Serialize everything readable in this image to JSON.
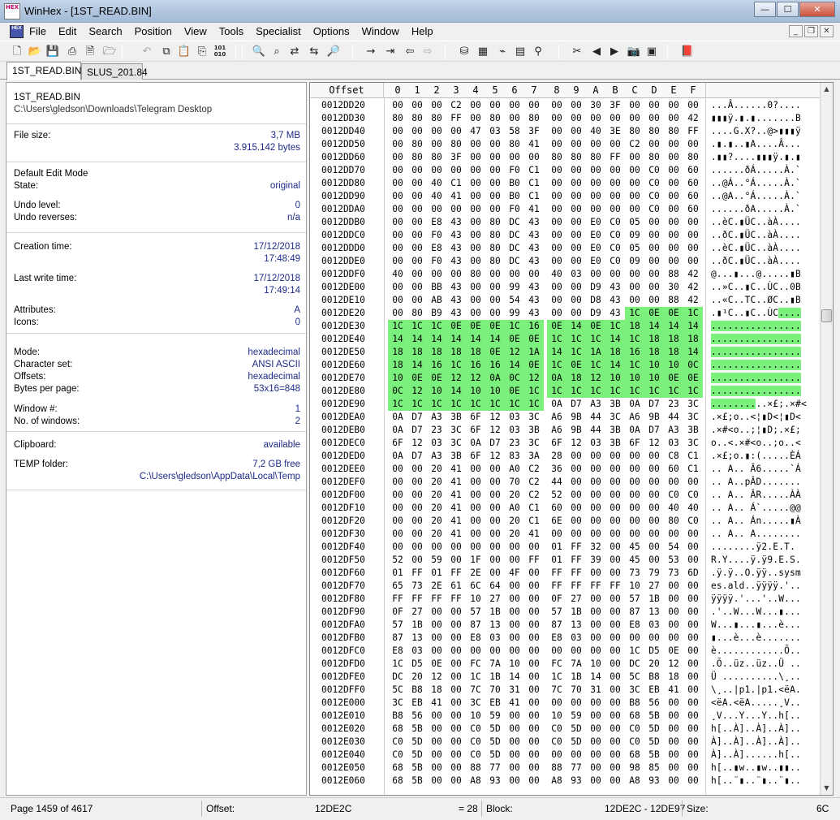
{
  "window": {
    "title": "WinHex - [1ST_READ.BIN]",
    "logo_text": "HEX",
    "minimize": "—",
    "maximize": "☐",
    "close": "✕"
  },
  "menu": {
    "items": [
      "File",
      "Edit",
      "Search",
      "Position",
      "View",
      "Tools",
      "Specialist",
      "Options",
      "Window",
      "Help"
    ]
  },
  "mdi": {
    "minimize": "_",
    "restore": "❐",
    "close": "✕"
  },
  "toolbar": {
    "icons": [
      {
        "name": "new-file-icon",
        "glyph": "🗋"
      },
      {
        "name": "open-folder-icon",
        "glyph": "📂"
      },
      {
        "name": "save-icon",
        "glyph": "💾",
        "dim": true
      },
      {
        "name": "print-icon",
        "glyph": "⎙"
      },
      {
        "name": "properties-icon",
        "glyph": "🗎"
      },
      {
        "name": "open-disk-icon",
        "glyph": "🗁"
      },
      {
        "name": "undo-icon",
        "glyph": "↶",
        "dim": true
      },
      {
        "name": "copy-icon",
        "glyph": "⧉"
      },
      {
        "name": "paste-icon",
        "glyph": "📋"
      },
      {
        "name": "paste-block-icon",
        "glyph": "⎘"
      },
      {
        "name": "binary-icon",
        "glyph": "101 010",
        "small": true
      },
      {
        "name": "find-text-icon",
        "glyph": "🔍"
      },
      {
        "name": "find-hex-icon",
        "glyph": "⌕"
      },
      {
        "name": "replace-text-icon",
        "glyph": "⇄"
      },
      {
        "name": "replace-hex-icon",
        "glyph": "⇆"
      },
      {
        "name": "find-again-icon",
        "glyph": "🔎"
      },
      {
        "name": "goto-offset-icon",
        "glyph": "→"
      },
      {
        "name": "goto-sector-icon",
        "glyph": "⇥"
      },
      {
        "name": "back-icon",
        "glyph": "⇦"
      },
      {
        "name": "forward-icon",
        "glyph": "⇨",
        "dim": true
      },
      {
        "name": "disk-editor-icon",
        "glyph": "⛁"
      },
      {
        "name": "ram-editor-icon",
        "glyph": "▦"
      },
      {
        "name": "disk-tools-icon",
        "glyph": "⌁"
      },
      {
        "name": "calculator-icon",
        "glyph": "▤"
      },
      {
        "name": "hash-icon",
        "glyph": "⚲"
      },
      {
        "name": "analyze-icon",
        "glyph": "✂"
      },
      {
        "name": "prev-page-icon",
        "glyph": "◀"
      },
      {
        "name": "next-page-icon",
        "glyph": "▶"
      },
      {
        "name": "camera-icon",
        "glyph": "📷"
      },
      {
        "name": "table-icon",
        "glyph": "▣"
      },
      {
        "name": "help-book-icon",
        "glyph": "📕"
      }
    ]
  },
  "tabs": [
    {
      "label": "1ST_READ.BIN",
      "active": true
    },
    {
      "label": "SLUS_201.84",
      "active": false
    }
  ],
  "info": {
    "file_name": "1ST_READ.BIN",
    "file_path": "C:\\Users\\gledson\\Downloads\\Telegram Desktop",
    "file_size_label": "File size:",
    "file_size_mb": "3,7 MB",
    "file_size_bytes": "3.915.142 bytes",
    "edit_mode_label": "Default Edit Mode",
    "state_label": "State:",
    "state_value": "original",
    "undo_level_label": "Undo level:",
    "undo_level_value": "0",
    "undo_reverses_label": "Undo reverses:",
    "undo_reverses_value": "n/a",
    "creation_label": "Creation time:",
    "creation_date": "17/12/2018",
    "creation_time": "17:48:49",
    "lastwrite_label": "Last write time:",
    "lastwrite_date": "17/12/2018",
    "lastwrite_time": "17:49:14",
    "attributes_label": "Attributes:",
    "attributes_value": "A",
    "icons_label": "Icons:",
    "icons_value": "0",
    "mode_label": "Mode:",
    "mode_value": "hexadecimal",
    "charset_label": "Character set:",
    "charset_value": "ANSI ASCII",
    "offsets_label": "Offsets:",
    "offsets_value": "hexadecimal",
    "bpp_label": "Bytes per page:",
    "bpp_value": "53x16=848",
    "window_num_label": "Window #:",
    "window_num_value": "1",
    "num_windows_label": "No. of windows:",
    "num_windows_value": "2",
    "clipboard_label": "Clipboard:",
    "clipboard_value": "available",
    "temp_label": "TEMP folder:",
    "temp_free": "7,2 GB free",
    "temp_path": "C:\\Users\\gledson\\AppData\\Local\\Temp"
  },
  "hex": {
    "offset_header": "Offset",
    "columns": [
      "0",
      "1",
      "2",
      "3",
      "4",
      "5",
      "6",
      "7",
      "8",
      "9",
      "A",
      "B",
      "C",
      "D",
      "E",
      "F"
    ],
    "selection_start": "0012DE2C",
    "selection_end": "0012DE97",
    "rows": [
      {
        "o": "0012DD20",
        "b": "00 00 00 C2 00 00 00 00 00 00 30 3F 00 00 00 00",
        "a": "...Â......0?...."
      },
      {
        "o": "0012DD30",
        "b": "80 80 80 FF 00 80 00 80 00 00 00 00 00 00 00 42",
        "a": "▮▮▮ÿ.▮.▮.......B"
      },
      {
        "o": "0012DD40",
        "b": "00 00 00 00 47 03 58 3F 00 00 40 3E 80 80 80 FF",
        "a": "....G.X?..@>▮▮▮ÿ"
      },
      {
        "o": "0012DD50",
        "b": "00 80 00 80 00 00 80 41 00 00 00 00 C2 00 00 00",
        "a": ".▮.▮..▮A....Â..."
      },
      {
        "o": "0012DD60",
        "b": "00 80 80 3F 00 00 00 00 80 80 80 FF 00 80 00 80",
        "a": ".▮▮?....▮▮▮ÿ.▮.▮"
      },
      {
        "o": "0012DD70",
        "b": "00 00 00 00 00 00 F0 C1 00 00 00 00 00 C0 00 60",
        "a": "......ðÁ.....À.`"
      },
      {
        "o": "0012DD80",
        "b": "00 00 40 C1 00 00 B0 C1 00 00 00 00 00 C0 00 60",
        "a": "..@Á..°Á.....À.`"
      },
      {
        "o": "0012DD90",
        "b": "00 00 40 41 00 00 B0 C1 00 00 00 00 00 C0 00 60",
        "a": "..@A..°Á.....À.`"
      },
      {
        "o": "0012DDA0",
        "b": "00 00 00 00 00 00 F0 41 00 00 00 00 00 C0 00 60",
        "a": "......ðA.....À.`"
      },
      {
        "o": "0012DDB0",
        "b": "00 00 E8 43 00 80 DC 43 00 00 E0 C0 05 00 00 00",
        "a": "..èC.▮ÜC..àÀ...."
      },
      {
        "o": "0012DDC0",
        "b": "00 00 F0 43 00 80 DC 43 00 00 E0 C0 09 00 00 00",
        "a": "..ðC.▮ÜC..àÀ...."
      },
      {
        "o": "0012DDD0",
        "b": "00 00 E8 43 00 80 DC 43 00 00 E0 C0 05 00 00 00",
        "a": "..èC.▮ÜC..àÀ...."
      },
      {
        "o": "0012DDE0",
        "b": "00 00 F0 43 00 80 DC 43 00 00 E0 C0 09 00 00 00",
        "a": "..ðC.▮ÜC..àÀ...."
      },
      {
        "o": "0012DDF0",
        "b": "40 00 00 00 80 00 00 00 40 03 00 00 00 00 88 42",
        "a": "@...▮...@.....▮B"
      },
      {
        "o": "0012DE00",
        "b": "00 00 BB 43 00 00 99 43 00 00 D9 43 00 00 30 42",
        "a": "..»C..▮C..ÙC..0B"
      },
      {
        "o": "0012DE10",
        "b": "00 00 AB 43 00 00 54 43 00 00 D8 43 00 00 88 42",
        "a": "..«C..TC..ØC..▮B"
      },
      {
        "o": "0012DE20",
        "b": "00 80 B9 43 00 00 99 43 00 00 D9 43 1C 0E 0E 1C",
        "a": ".▮¹C..▮C..ÙC....",
        "sel_from": 12
      },
      {
        "o": "0012DE30",
        "b": "1C 1C 1C 0E 0E 0E 1C 16 0E 14 0E 1C 18 14 14 14",
        "a": "................",
        "sel_from": 0
      },
      {
        "o": "0012DE40",
        "b": "14 14 14 14 14 14 0E 0E 1C 1C 1C 14 1C 18 18 18",
        "a": "................",
        "sel_from": 0
      },
      {
        "o": "0012DE50",
        "b": "18 18 18 18 18 0E 12 1A 14 1C 1A 18 16 18 18 14",
        "a": "................",
        "sel_from": 0
      },
      {
        "o": "0012DE60",
        "b": "18 14 16 1C 16 16 14 0E 1C 0E 1C 14 1C 10 10 0C",
        "a": "................",
        "sel_from": 0
      },
      {
        "o": "0012DE70",
        "b": "10 0E 0E 12 12 0A 0C 12 0A 18 12 10 10 10 0E 0E",
        "a": "................",
        "sel_from": 0
      },
      {
        "o": "0012DE80",
        "b": "0C 12 10 14 10 10 0E 1C 1C 1C 1C 1C 1C 1C 1C 1C",
        "a": "................",
        "sel_from": 0
      },
      {
        "o": "0012DE90",
        "b": "1C 1C 1C 1C 1C 1C 1C 1C 0A D7 A3 3B 0A D7 23 3C",
        "a": "..........×£;.×#<",
        "sel_from": 0,
        "sel_to": 7
      },
      {
        "o": "0012DEA0",
        "b": "0A D7 A3 3B 6F 12 03 3C A6 9B 44 3C A6 9B 44 3C",
        "a": ".×£;o..<¦▮D<¦▮D<"
      },
      {
        "o": "0012DEB0",
        "b": "0A D7 23 3C 6F 12 03 3B A6 9B 44 3B 0A D7 A3 3B",
        "a": ".×#<o..;¦▮D;.×£;"
      },
      {
        "o": "0012DEC0",
        "b": "6F 12 03 3C 0A D7 23 3C 6F 12 03 3B 6F 12 03 3C",
        "a": "o..<.×#<o..;o..<"
      },
      {
        "o": "0012DED0",
        "b": "0A D7 A3 3B 6F 12 83 3A 28 00 00 00 00 00 C8 C1",
        "a": ".×£;o.▮:(.....ÈÁ"
      },
      {
        "o": "0012DEE0",
        "b": "00 00 20 41 00 00 A0 C2 36 00 00 00 00 00 60 C1",
        "a": ".. A.. Â6.....`Á"
      },
      {
        "o": "0012DEF0",
        "b": "00 00 20 41 00 00 70 C2 44 00 00 00 00 00 00 00",
        "a": ".. A..pÂD......."
      },
      {
        "o": "0012DF00",
        "b": "00 00 20 41 00 00 20 C2 52 00 00 00 00 00 C0 C0",
        "a": ".. A.. ÂR.....ÀÀ"
      },
      {
        "o": "0012DF10",
        "b": "00 00 20 41 00 00 A0 C1 60 00 00 00 00 00 40 40",
        "a": ".. A.. Á`.....@@"
      },
      {
        "o": "0012DF20",
        "b": "00 00 20 41 00 00 20 C1 6E 00 00 00 00 00 80 C0",
        "a": ".. A.. Án.....▮À"
      },
      {
        "o": "0012DF30",
        "b": "00 00 20 41 00 00 20 41 00 00 00 00 00 00 00 00",
        "a": ".. A.. A........"
      },
      {
        "o": "0012DF40",
        "b": "00 00 00 00 00 00 00 00 01 FF 32 00 45 00 54 00",
        "a": "........ÿ2.E.T."
      },
      {
        "o": "0012DF50",
        "b": "52 00 59 00 1F 00 00 FF 01 FF 39 00 45 00 53 00",
        "a": "R.Y....ÿ.ÿ9.E.S."
      },
      {
        "o": "0012DF60",
        "b": "01 FF 01 FF 2E 00 4F 00 FF FF 00 00 73 79 73 6D",
        "a": ".ÿ.ÿ..O.ÿÿ..sysm"
      },
      {
        "o": "0012DF70",
        "b": "65 73 2E 61 6C 64 00 00 FF FF FF FF 10 27 00 00",
        "a": "es.ald..ÿÿÿÿ.'.."
      },
      {
        "o": "0012DF80",
        "b": "FF FF FF FF 10 27 00 00 0F 27 00 00 57 1B 00 00",
        "a": "ÿÿÿÿ.'...'..W..."
      },
      {
        "o": "0012DF90",
        "b": "0F 27 00 00 57 1B 00 00 57 1B 00 00 87 13 00 00",
        "a": ".'..W...W...▮..."
      },
      {
        "o": "0012DFA0",
        "b": "57 1B 00 00 87 13 00 00 87 13 00 00 E8 03 00 00",
        "a": "W...▮...▮...è..."
      },
      {
        "o": "0012DFB0",
        "b": "87 13 00 00 E8 03 00 00 E8 03 00 00 00 00 00 00",
        "a": "▮...è...è......."
      },
      {
        "o": "0012DFC0",
        "b": "E8 03 00 00 00 00 00 00 00 00 00 00 1C D5 0E 00",
        "a": "è............Õ.."
      },
      {
        "o": "0012DFD0",
        "b": "1C D5 0E 00 FC 7A 10 00 FC 7A 10 00 DC 20 12 00",
        "a": ".Õ..üz..üz..Ü .."
      },
      {
        "o": "0012DFE0",
        "b": "DC 20 12 00 1C 1B 14 00 1C 1B 14 00 5C B8 18 00",
        "a": "Ü ..........\\¸.."
      },
      {
        "o": "0012DFF0",
        "b": "5C B8 18 00 7C 70 31 00 7C 70 31 00 3C EB 41 00",
        "a": "\\¸..|p1.|p1.<ëA."
      },
      {
        "o": "0012E000",
        "b": "3C EB 41 00 3C EB 41 00 00 00 00 00 B8 56 00 00",
        "a": "<ëA.<ëA.....¸V.."
      },
      {
        "o": "0012E010",
        "b": "B8 56 00 00 10 59 00 00 10 59 00 00 68 5B 00 00",
        "a": "¸V...Y...Y..h[.."
      },
      {
        "o": "0012E020",
        "b": "68 5B 00 00 C0 5D 00 00 C0 5D 00 00 C0 5D 00 00",
        "a": "h[..À]..À]..À].."
      },
      {
        "o": "0012E030",
        "b": "C0 5D 00 00 C0 5D 00 00 C0 5D 00 00 C0 5D 00 00",
        "a": "À]..À]..À]..À].."
      },
      {
        "o": "0012E040",
        "b": "C0 5D 00 00 C0 5D 00 00 00 00 00 00 68 5B 00 00",
        "a": "À]..À]......h[.."
      },
      {
        "o": "0012E050",
        "b": "68 5B 00 00 88 77 00 00 88 77 00 00 98 85 00 00",
        "a": "h[..▮w..▮w..▮▮.."
      },
      {
        "o": "0012E060",
        "b": "68 5B 00 00 A8 93 00 00 A8 93 00 00 A8 93 00 00",
        "a": "h[..¨▮..¨▮..¨▮.."
      }
    ]
  },
  "status": {
    "page": "Page 1459 of 4617",
    "offset_label": "Offset:",
    "offset_value": "12DE2C",
    "value": "= 28",
    "block_label": "Block:",
    "block_value": "12DE2C - 12DE97",
    "size_label": "Size:",
    "size_value": "6C"
  }
}
